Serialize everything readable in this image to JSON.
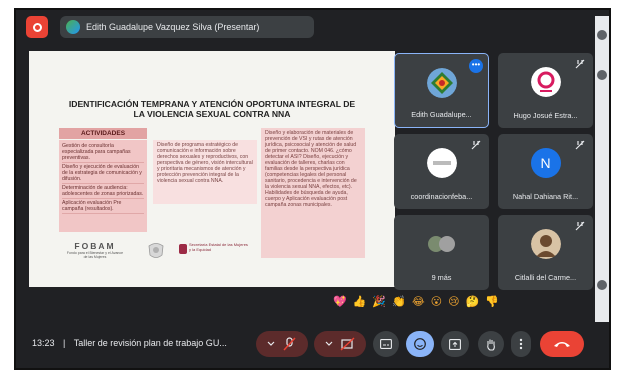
{
  "window": {
    "presenter_label": "Edith Guadalupe Vazquez Silva (Presentar)"
  },
  "slide": {
    "title": "IDENTIFICACIÓN TEMPRANA Y ATENCIÓN OPORTUNA INTEGRAL DE LA VIOLENCIA SEXUAL CONTRA NNA",
    "activities_header": "ACTIVIDADES",
    "activities": [
      "Gestión de consultoría especializada para campañas preventivas.",
      "Diseño y ejecución de evaluación de la estrategia de comunicación y difusión.",
      "Determinación de audiencia: adolescentes de zonas priorizadas.",
      "Aplicación evaluación Pre campaña (resultados)."
    ],
    "middle_text": "Diseño de programa estratégico de comunicación e información sobre derechos sexuales y reproductivos, con perspectiva de género, visión intercultural y prioritaria mecanismos de atención y protección prevención integral de la violencia sexual contra NNA.",
    "right_text": "Diseño y elaboración de materiales de prevención de VSI y rutas de atención jurídica, psicosocial y atención de salud de primer contacto. NOM 046. ¿cómo detectar el ASI? Diseño, ejecución y evaluación de talleres, charlas con familias desde la perspectiva jurídica (competencias legales del personal sanitario, procedencia e intervención de la violencia sexual NNA, efectos, etc). Habilidades de búsqueda de ayuda, cuerpo y Aplicación evaluación post campaña zonas municipales.",
    "logo_fobam": "FOBAM",
    "logo_fobam_sub": "Fondo para el Bienestar y el Avance de las Mujeres",
    "logo_gov": "Secretaría Estatal de las Mujeres y la Equidad"
  },
  "participants": [
    {
      "name": "Edith Guadalupe...",
      "active": true
    },
    {
      "name": "Hugo Josué Estra..."
    },
    {
      "name": "coordinacionfeba..."
    },
    {
      "name": "Nahal Dahiana Rit...",
      "initial": "N"
    },
    {
      "name": "9 más"
    },
    {
      "name": "Citlalli del Carme..."
    }
  ],
  "reactions": [
    "💖",
    "👍",
    "🎉",
    "👏",
    "😂",
    "😮",
    "😢",
    "🤔",
    "👎"
  ],
  "bottombar": {
    "time": "13:23",
    "meeting_title": "Taller de revisión plan de trabajo GU..."
  },
  "colors": {
    "background": "#202124",
    "tile": "#3c4043",
    "accent_blue": "#8ab4f8",
    "leave_red": "#ea4335",
    "muted_red": "#5c2b2b"
  }
}
